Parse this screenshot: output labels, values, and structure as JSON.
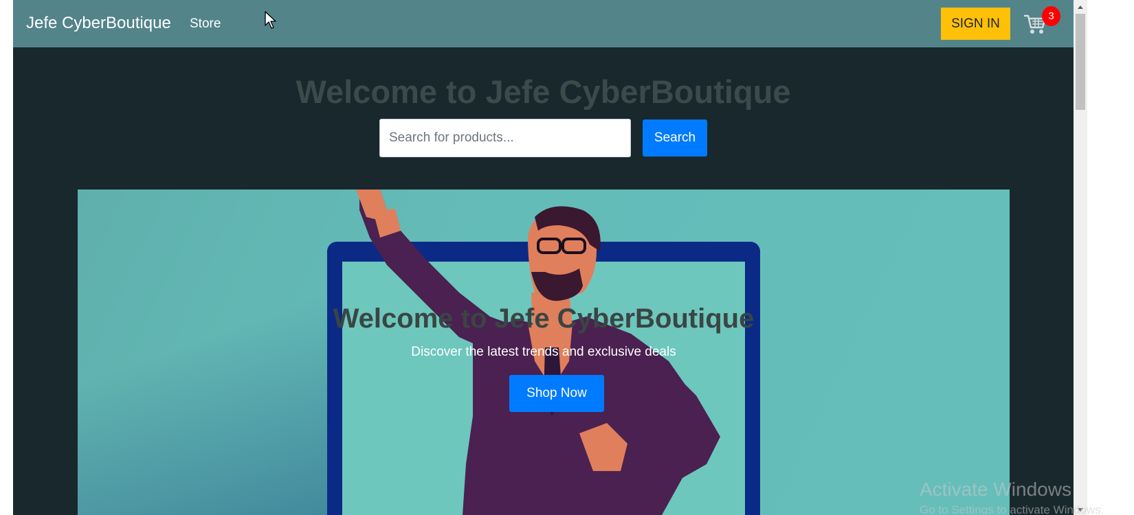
{
  "navbar": {
    "brand": "Jefe CyberBoutique",
    "store_label": "Store",
    "signin_label": "SIGN IN",
    "cart_icon": "cart-icon",
    "cart_count": "3"
  },
  "header": {
    "title": "Welcome to Jefe CyberBoutique",
    "search_placeholder": "Search for products...",
    "search_button": "Search"
  },
  "hero": {
    "title": "Welcome to Jefe CyberBoutique",
    "subtitle": "Discover the latest trends and exclusive deals",
    "cta": "Shop Now"
  },
  "watermark": {
    "title": "Activate Windows",
    "subtitle": "Go to Settings to activate Windows."
  },
  "colors": {
    "navbar": "#52848a",
    "page_bg": "#18282c",
    "signin": "#ffc107",
    "primary": "#007bff",
    "badge": "#ff0000",
    "hero_bg": "#66bebb"
  }
}
